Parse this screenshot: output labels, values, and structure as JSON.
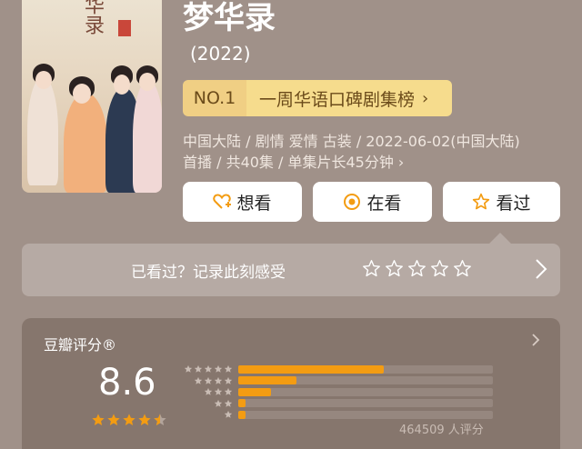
{
  "title": "梦华录",
  "year": "(2022)",
  "poster": {
    "calligraphy": "华录"
  },
  "rank": {
    "badge": "NO.1",
    "label": "一周华语口碑剧集榜",
    "chevron": "›"
  },
  "meta": {
    "line1": "中国大陆 / 剧情 爱情 古装 / 2022-06-02(中国大陆)",
    "line2": "首播 / 共40集 / 单集片长45分钟 ›"
  },
  "actions": [
    {
      "label": "想看",
      "icon": "heart-plus-icon"
    },
    {
      "label": "在看",
      "icon": "target-icon"
    },
    {
      "label": "看过",
      "icon": "star-outline-icon"
    }
  ],
  "mark": {
    "prompt": "已看过？记录此刻感受",
    "stars": 5
  },
  "rating": {
    "title": "豆瓣评分®",
    "score": "8.6",
    "stars": 4.5,
    "distribution": [
      {
        "stars": 5,
        "fraction": 0.57
      },
      {
        "stars": 4,
        "fraction": 0.23
      },
      {
        "stars": 3,
        "fraction": 0.13
      },
      {
        "stars": 2,
        "fraction": 0.03
      },
      {
        "stars": 1,
        "fraction": 0.03
      }
    ],
    "count": "464509 人评分"
  },
  "colors": {
    "background": "#a09189",
    "rank_badge": "#f0cf84",
    "rank_bar": "#f6dc8d",
    "accent": "#f39c12",
    "rating_panel": "#86766d"
  }
}
